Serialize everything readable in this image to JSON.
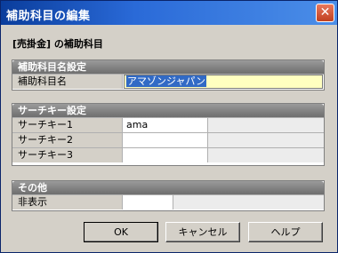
{
  "window": {
    "title": "補助科目の編集",
    "close_glyph": "✕"
  },
  "heading": "[売掛金] の補助科目",
  "groups": {
    "name_settings": {
      "header": "補助科目名設定",
      "rows": [
        {
          "label": "補助科目名",
          "value": "アマゾンジャパン"
        }
      ]
    },
    "search_keys": {
      "header": "サーチキー設定",
      "rows": [
        {
          "label": "サーチキー1",
          "value": "ama"
        },
        {
          "label": "サーチキー2",
          "value": ""
        },
        {
          "label": "サーチキー3",
          "value": ""
        }
      ]
    },
    "other": {
      "header": "その他",
      "rows": [
        {
          "label": "非表示",
          "value": ""
        }
      ]
    }
  },
  "buttons": {
    "ok": "OK",
    "cancel": "キャンセル",
    "help": "ヘルプ"
  },
  "colors": {
    "titlebar": "#0a3d9c",
    "selection": "#316ac5",
    "input_bg": "#ffffc0"
  }
}
